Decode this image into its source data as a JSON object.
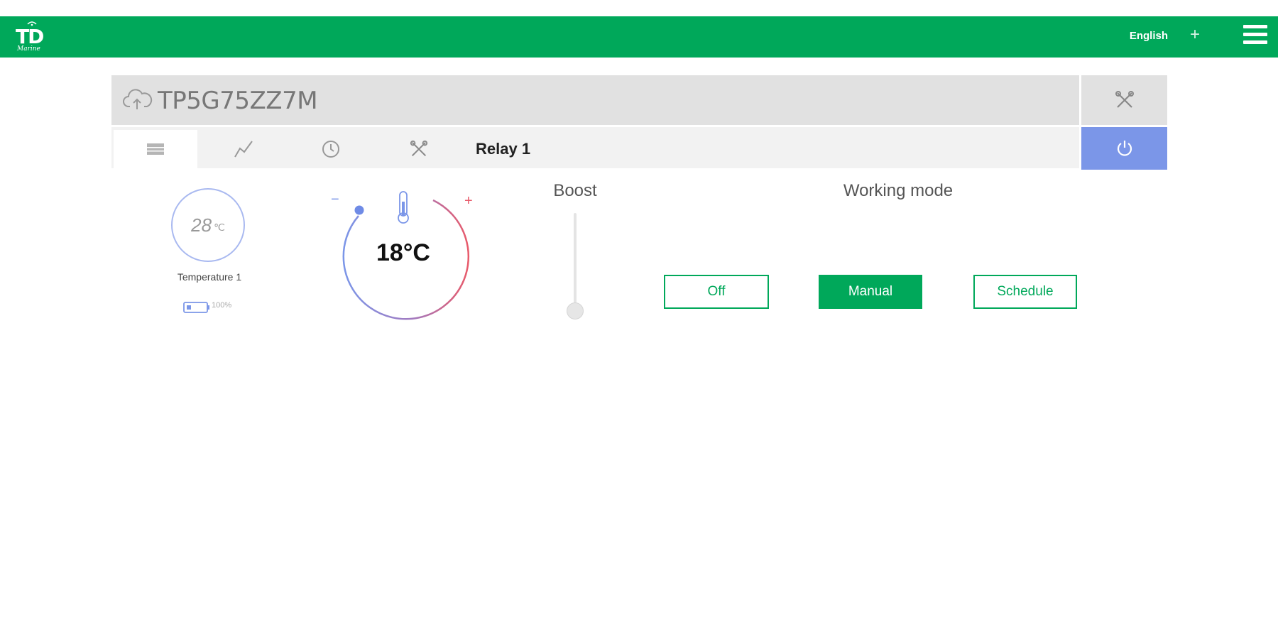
{
  "header": {
    "logo_text": "TD",
    "logo_sub": "Marine",
    "language": "English",
    "add_symbol": "+",
    "accent_color": "#00a85a"
  },
  "device": {
    "name": "TP5G75ZZ7M",
    "cloud_icon": "cloud-upload-icon",
    "tools_icon": "tools-icon"
  },
  "tabs": [
    {
      "icon": "list-icon",
      "active": true
    },
    {
      "icon": "chart-line-icon",
      "active": false
    },
    {
      "icon": "clock-icon",
      "active": false
    },
    {
      "icon": "tools-icon",
      "active": false
    }
  ],
  "relay": {
    "label": "Relay 1",
    "power_icon": "power-icon",
    "power_color": "#7b96e8"
  },
  "sensor": {
    "value": "28",
    "unit": "℃",
    "label": "Temperature 1",
    "battery": "100%"
  },
  "thermostat": {
    "setpoint": "18°C",
    "minus": "−",
    "plus": "+",
    "thermometer_icon": "thermometer-icon"
  },
  "boost": {
    "label": "Boost",
    "level": 0
  },
  "working_mode": {
    "label": "Working mode",
    "options": [
      "Off",
      "Manual",
      "Schedule"
    ],
    "selected": "Manual"
  }
}
